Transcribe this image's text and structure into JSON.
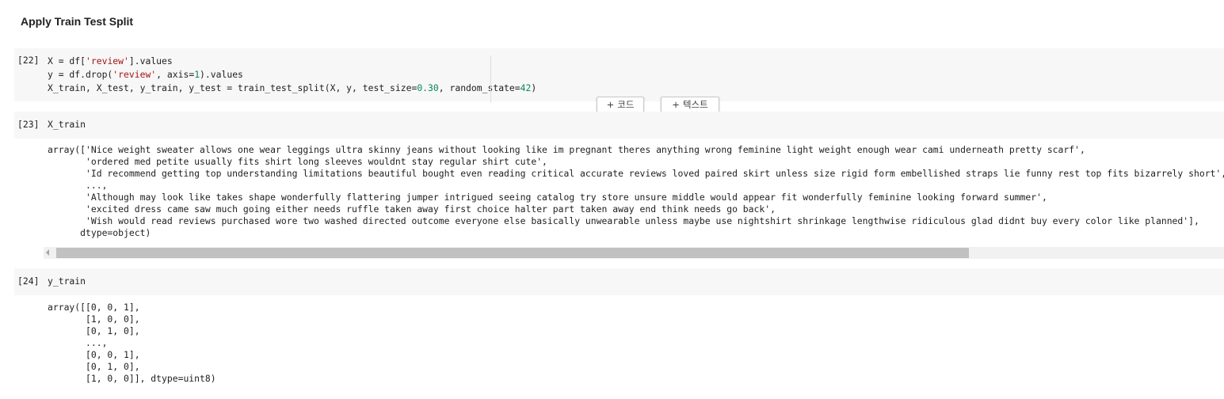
{
  "section": {
    "title": "Apply Train Test Split"
  },
  "cells": {
    "c22": {
      "prompt": "[22]",
      "code": {
        "l1_a": "X = df[",
        "l1_s": "'review'",
        "l1_b": "].values",
        "l2_a": "y = df.drop(",
        "l2_s": "'review'",
        "l2_b": ", axis=",
        "l2_n": "1",
        "l2_c": ").values",
        "l3_a": "X_train, X_test, y_train, y_test = train_test_split(X, y, test_size=",
        "l3_n1": "0.30",
        "l3_b": ", random_state=",
        "l3_n2": "42",
        "l3_c": ")"
      }
    },
    "c23": {
      "prompt": "[23]",
      "code": "X_train",
      "output": "array(['Nice weight sweater allows one wear leggings ultra skinny jeans without looking like im pregnant theres anything wrong feminine light weight enough wear cami underneath pretty scarf',\n       'ordered med petite usually fits shirt long sleeves wouldnt stay regular shirt cute',\n       'Id recommend getting top understanding limitations beautiful bought even reading critical accurate reviews loved paired skirt unless size rigid form embellished straps lie funny rest top fits bizarrely short',\n       ...,\n       'Although may look like takes shape wonderfully flattering jumper intrigued seeing catalog try store unsure middle would appear fit wonderfully feminine looking forward summer',\n       'excited dress came saw much going either needs ruffle taken away first choice halter part taken away end think needs go back',\n       'Wish would read reviews purchased wore two washed directed outcome everyone else basically unwearable unless maybe use nightshirt shrinkage lengthwise ridiculous glad didnt buy every color like planned'],\n      dtype=object)"
    },
    "c24": {
      "prompt": "[24]",
      "code": "y_train",
      "output": "array([[0, 0, 1],\n       [1, 0, 0],\n       [0, 1, 0],\n       ...,\n       [0, 0, 1],\n       [0, 1, 0],\n       [1, 0, 0]], dtype=uint8)"
    }
  },
  "toolbar": {
    "add_code_plus": "+",
    "add_code_label": "코드",
    "add_text_plus": "+",
    "add_text_label": "텍스트"
  },
  "colors": {
    "string": "#a31515",
    "number": "#098658",
    "cell_bg": "#f7f7f7"
  }
}
